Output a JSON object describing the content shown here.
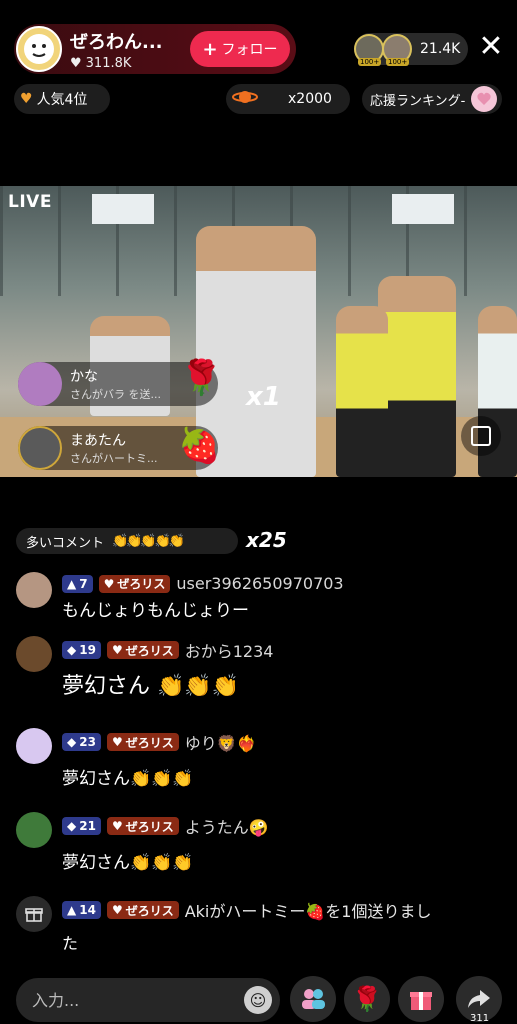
{
  "host": {
    "name": "ぜろわん...",
    "likes": "311.8K",
    "follow_label": "フォロー"
  },
  "viewers": {
    "count": "21.4K",
    "badge1": "100+",
    "badge2": "100+"
  },
  "chips": {
    "rank": "人気4位",
    "coins": "x2000",
    "support": "応援ランキング-"
  },
  "video": {
    "live_label": "LIVE",
    "overlays": [
      {
        "name": "かな",
        "sub": "さんがバラ を送..."
      },
      {
        "name": "まあたん",
        "sub": "さんがハートミ..."
      }
    ],
    "gift_multiplier": "x1"
  },
  "comments_header": {
    "label": "多いコメント",
    "claps": "👏👏👏👏👏",
    "count": "x25"
  },
  "comments": [
    {
      "level": "7",
      "fan": "ぜろリス",
      "user": "user3962650970703",
      "text": "もんじょりもんじょりー"
    },
    {
      "level": "19",
      "fan": "ぜろリス",
      "user": "おから1234",
      "text": "夢幻さん 👏👏👏"
    },
    {
      "level": "23",
      "fan": "ぜろリス",
      "user": "ゆり🦁❤️‍🔥",
      "text": "夢幻さん👏👏👏"
    },
    {
      "level": "21",
      "fan": "ぜろリス",
      "user": "ようたん🤪",
      "text": "夢幻さん👏👏👏"
    }
  ],
  "system_message": {
    "level": "14",
    "fan": "ぜろリス",
    "text_line1": "Akiがハートミー🍓を1個送りまし",
    "text_line2": "た"
  },
  "bottom": {
    "input_placeholder": "入力...",
    "share_count": "311"
  },
  "colors": {
    "follow": "#ee2a4f",
    "level_badge": "#2e3a8c",
    "fan_badge": "#8a2a14"
  }
}
